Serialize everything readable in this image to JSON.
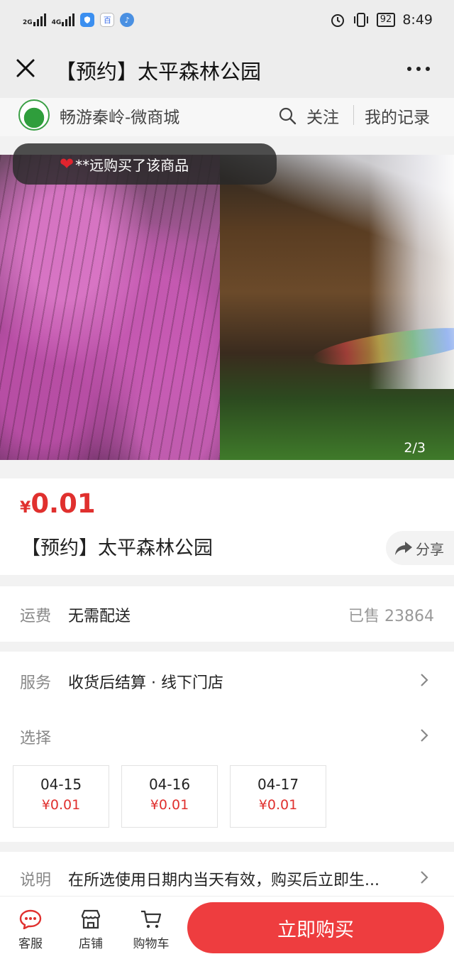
{
  "status_bar": {
    "net1": "2G",
    "net2": "4G",
    "app_icon_text": "百",
    "battery": "92",
    "time": "8:49"
  },
  "title_bar": {
    "title": "【预约】太平森林公园"
  },
  "shop": {
    "name": "畅游秦岭-微商城",
    "follow_label": "关注",
    "records_label": "我的记录"
  },
  "gallery": {
    "buyer_toast": "**远购买了该商品",
    "page_indicator": "2/3"
  },
  "product": {
    "currency": "¥",
    "price": "0.01",
    "name": "【预约】太平森林公园",
    "share_label": "分享"
  },
  "freight": {
    "label": "运费",
    "value": "无需配送",
    "sold": "已售 23864"
  },
  "service": {
    "label": "服务",
    "value": "收货后结算 · 线下门店"
  },
  "select": {
    "label": "选择",
    "dates": [
      {
        "date": "04-15",
        "price": "¥0.01"
      },
      {
        "date": "04-16",
        "price": "¥0.01"
      },
      {
        "date": "04-17",
        "price": "¥0.01"
      }
    ]
  },
  "note": {
    "label": "说明",
    "value": "在所选使用日期内当天有效，购买后立即生..."
  },
  "bottom_bar": {
    "service_label": "客服",
    "store_label": "店铺",
    "cart_label": "购物车",
    "buy_label": "立即购买"
  },
  "colors": {
    "accent": "#ee3d3f",
    "price": "#e0302e",
    "title_bar_bg": "#ededed"
  }
}
